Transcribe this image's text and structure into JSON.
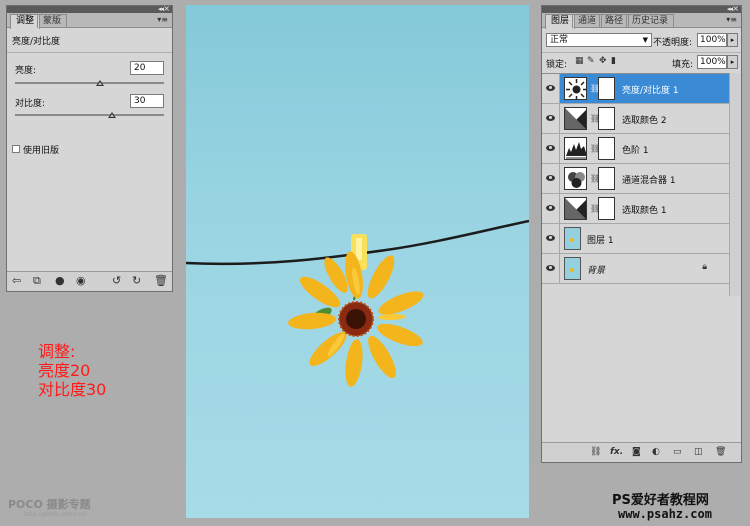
{
  "adjustments_panel": {
    "tabs": [
      {
        "label": "调整",
        "active": true
      },
      {
        "label": "蒙版",
        "active": false
      }
    ],
    "title": "亮度/对比度",
    "fields": [
      {
        "label": "亮度:",
        "value": "20"
      },
      {
        "label": "对比度:",
        "value": "30"
      }
    ],
    "checkbox_label": "使用旧版",
    "footer_icons": [
      "back-arrow-icon",
      "expand-view-icon",
      "clip-layer-icon",
      "visibility-eye-icon",
      "previous-state-icon",
      "reset-icon",
      "trash-icon"
    ]
  },
  "layers_panel": {
    "tabs": [
      {
        "label": "图层",
        "active": true
      },
      {
        "label": "通道",
        "active": false
      },
      {
        "label": "路径",
        "active": false
      },
      {
        "label": "历史记录",
        "active": false
      }
    ],
    "blend_mode": "正常",
    "opacity_label": "不透明度:",
    "opacity_value": "100%",
    "lock_label": "锁定:",
    "fill_label": "填充:",
    "fill_value": "100%",
    "layers": [
      {
        "name": "亮度/对比度 1",
        "type": "brightness-contrast",
        "selected": true
      },
      {
        "name": "选取颜色 2",
        "type": "selective-color",
        "selected": false
      },
      {
        "name": "色阶 1",
        "type": "levels",
        "selected": false
      },
      {
        "name": "通道混合器 1",
        "type": "channel-mixer",
        "selected": false
      },
      {
        "name": "选取颜色 1",
        "type": "selective-color",
        "selected": false
      },
      {
        "name": "图层 1",
        "type": "pixel",
        "selected": false
      },
      {
        "name": "背景",
        "type": "background",
        "selected": false
      }
    ]
  },
  "annotation": {
    "line1": "调整:",
    "line2": "亮度20",
    "line3": "对比度30"
  },
  "watermarks": {
    "poco": "POCO 摄影专题",
    "poco_url": "http://photo.poco.cn/",
    "site_name": "PS爱好者教程网",
    "site_url": "www.psahz.com"
  },
  "colors": {
    "selection_blue": "#3a8ad6",
    "annotation_red": "#ff1a1a",
    "sky": "#9ad4e2",
    "flower": "#f4b41c"
  }
}
